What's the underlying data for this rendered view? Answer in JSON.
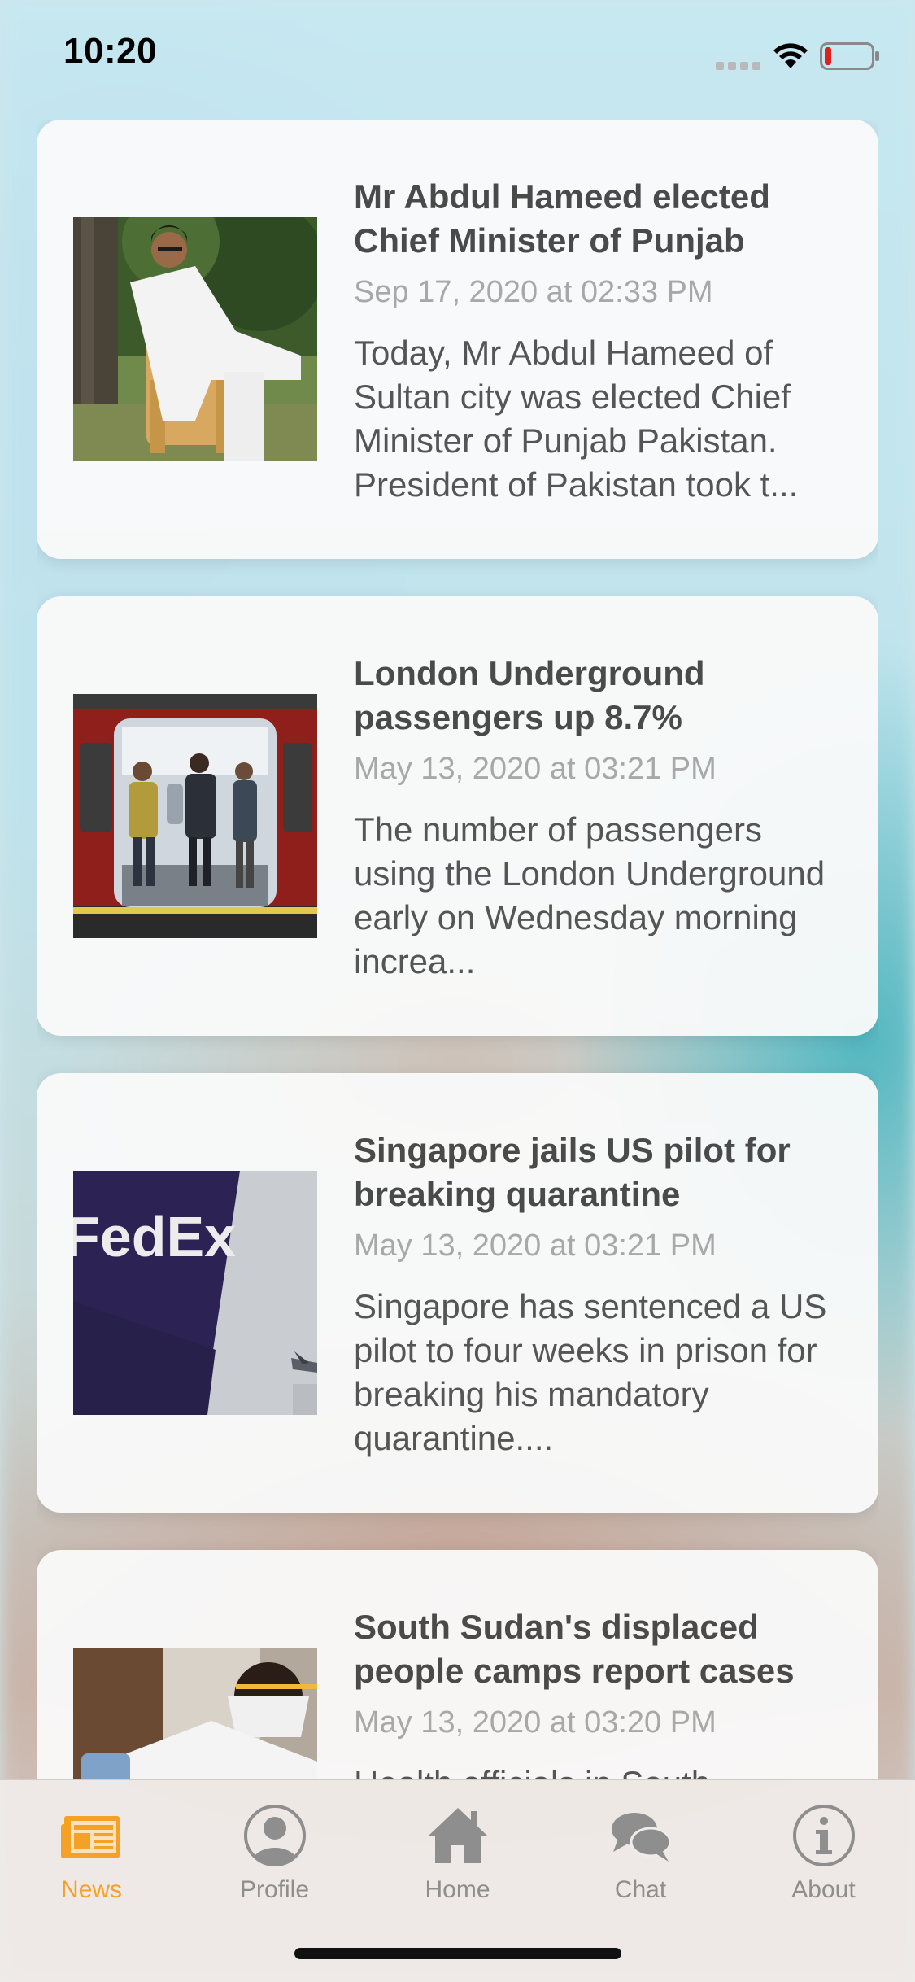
{
  "status_bar": {
    "time": "10:20",
    "icons": [
      "signal-icon",
      "wifi-icon",
      "battery-icon"
    ]
  },
  "articles": [
    {
      "title": "Mr Abdul Hameed elected Chief Minister of Punjab",
      "date": "Sep 17, 2020 at 02:33 PM",
      "summary": "Today, Mr Abdul Hameed of Sultan city was elected Chief Minister of Punjab Pakistan. President of Pakistan took t..."
    },
    {
      "title": "London Underground passengers up 8.7%",
      "date": "May 13, 2020 at 03:21 PM",
      "summary": "The number of passengers using the London Underground early on Wednesday morning increa..."
    },
    {
      "title": "Singapore jails US pilot for breaking quarantine",
      "date": "May 13, 2020 at 03:21 PM",
      "summary": "Singapore has sentenced a US pilot to four weeks in prison for breaking his mandatory quarantine...."
    },
    {
      "title": "South Sudan's displaced people camps report cases",
      "date": "May 13, 2020 at 03:20 PM",
      "summary": "Health officials in South"
    }
  ],
  "thumb_text": {
    "fedex_logo": "FedEx"
  },
  "tabs": [
    {
      "label": "News",
      "icon": "newspaper-icon",
      "active": true
    },
    {
      "label": "Profile",
      "icon": "profile-icon",
      "active": false
    },
    {
      "label": "Home",
      "icon": "home-icon",
      "active": false
    },
    {
      "label": "Chat",
      "icon": "chat-icon",
      "active": false
    },
    {
      "label": "About",
      "icon": "info-icon",
      "active": false
    }
  ],
  "colors": {
    "accent": "#f5a128",
    "inactive": "#8e8e8e",
    "title": "#4a4a4a",
    "date": "#a8a8a8"
  }
}
